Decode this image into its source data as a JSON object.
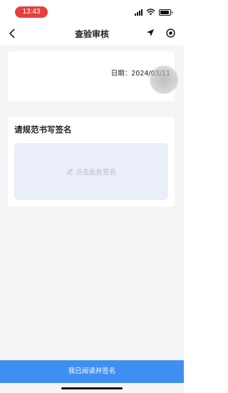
{
  "status_bar": {
    "time": "13:43"
  },
  "nav": {
    "title": "查验审核"
  },
  "date_card": {
    "date_text": "日期：2024/03/11"
  },
  "signature": {
    "title": "请规范书写签名",
    "hint": "点击此处签名"
  },
  "footer": {
    "submit_label": "我已阅读并签名"
  },
  "colors": {
    "primary": "#3f8ff2",
    "status_pill": "#e4413c",
    "pad_bg": "#e9eef9",
    "page_bg": "#f4f5f7"
  }
}
